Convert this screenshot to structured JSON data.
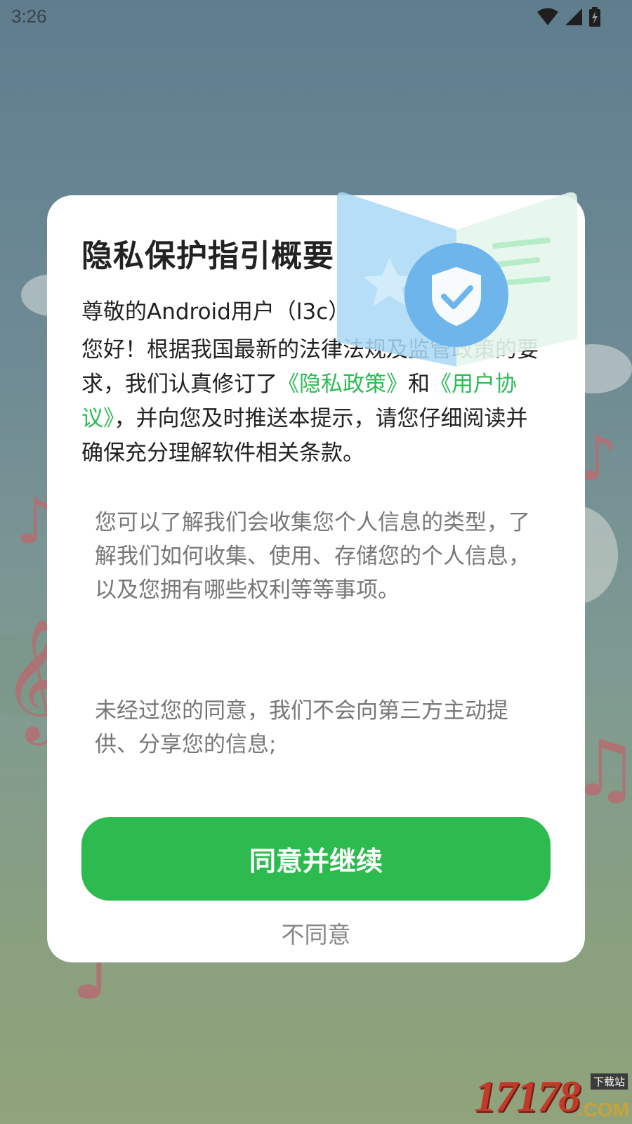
{
  "status_bar": {
    "time": "3:26"
  },
  "dialog": {
    "title": "隐私保护指引概要",
    "greeting": "尊敬的Android用户（l3c）",
    "intro": {
      "part1": "您好！根据我国最新的法律法规及监管政策的要求，我们认真修订了",
      "privacy_link": "《隐私政策》",
      "part2": "和",
      "agreement_link": "《用户协议》",
      "part3": "，并向您及时推送本提示，请您仔细阅读并确保充分理解软件相关条款。"
    },
    "details": [
      "您可以了解我们会收集您个人信息的类型，了解我们如何收集、使用、存储您的个人信息，以及您拥有哪些权利等等事项。",
      "未经过您的同意，我们不会向第三方主动提供、分享您的信息;"
    ],
    "agree_label": "同意并继续",
    "disagree_label": "不同意"
  },
  "watermark": {
    "number": "17178",
    "download_tag": "下载站",
    "domain": ".COM"
  },
  "colors": {
    "accent": "#2dbb50",
    "link": "#2dbb55",
    "dialog_bg": "#ffffff",
    "title_text": "#222222",
    "detail_text": "#777777"
  },
  "icons": [
    "wifi-icon",
    "signal-icon",
    "battery-icon",
    "shield-check-icon"
  ]
}
